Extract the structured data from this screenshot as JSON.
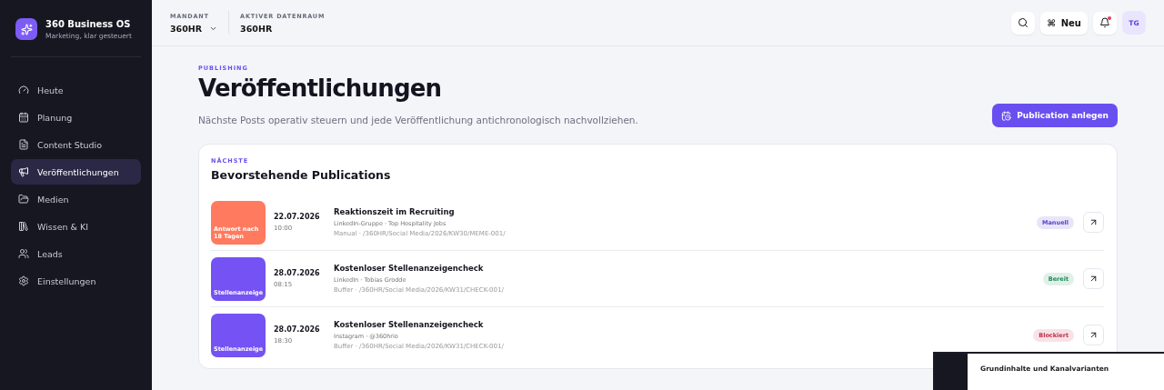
{
  "brand": {
    "title": "360 Business OS",
    "subtitle": "Marketing, klar gesteuert"
  },
  "nav": [
    {
      "label": "Heute",
      "selected": false
    },
    {
      "label": "Planung",
      "selected": false
    },
    {
      "label": "Content Studio",
      "selected": false
    },
    {
      "label": "Veröffentlichungen",
      "selected": true
    },
    {
      "label": "Medien",
      "selected": false
    },
    {
      "label": "Wissen & KI",
      "selected": false
    },
    {
      "label": "Leads",
      "selected": false
    },
    {
      "label": "Einstellungen",
      "selected": false
    }
  ],
  "topbar": {
    "mandant_label": "MANDANT",
    "mandant_value": "360HR",
    "room_label": "AKTIVER DATENRAUM",
    "room_value": "360HR",
    "new_button": "Neu",
    "new_shortcut": "⌘",
    "notification_dot": true,
    "avatar": "TG"
  },
  "header": {
    "eyebrow": "PUBLISHING",
    "title": "Veröffentlichungen",
    "subtitle": "Nächste Posts operativ steuern und jede Veröffentlichung antichronologisch nachvollziehen.",
    "action": "Publication anlegen"
  },
  "upcoming": {
    "eyebrow": "NÄCHSTE",
    "title": "Bevorstehende Publications",
    "rows": [
      {
        "thumb": {
          "text": "Antwort nach 18 Tagen",
          "color": "#ff7a5e"
        },
        "date": "22.07.2026",
        "time": "10:00",
        "title": "Reaktionszeit im Recruiting",
        "channel": "LinkedIn-Gruppe · Top Hospitality Jobs",
        "path": "Manual · /360HR/Social Media/2026/KW30/MEME-001/",
        "status": {
          "label": "Manuell",
          "color": "#5b3fd3"
        }
      },
      {
        "thumb": {
          "text": "Stellenanzeige",
          "color": "#7452f3"
        },
        "date": "28.07.2026",
        "time": "08:15",
        "title": "Kostenloser Stellenanzeigencheck",
        "channel": "LinkedIn · Tobias Grodde",
        "path": "Buffer · /360HR/Social Media/2026/KW31/CHECK-001/",
        "status": {
          "label": "Bereit",
          "color": "#1f8a5a"
        }
      },
      {
        "thumb": {
          "text": "Stellenanzeige",
          "color": "#7452f3"
        },
        "date": "28.07.2026",
        "time": "18:30",
        "title": "Kostenloser Stellenanzeigencheck",
        "channel": "Instagram · @360hrio",
        "path": "Buffer · /360HR/Social Media/2026/KW31/CHECK-001/",
        "status": {
          "label": "Blockiert",
          "color": "#c23048"
        }
      }
    ]
  },
  "preview": {
    "title": "Grundinhalte und Kanalvarianten"
  }
}
